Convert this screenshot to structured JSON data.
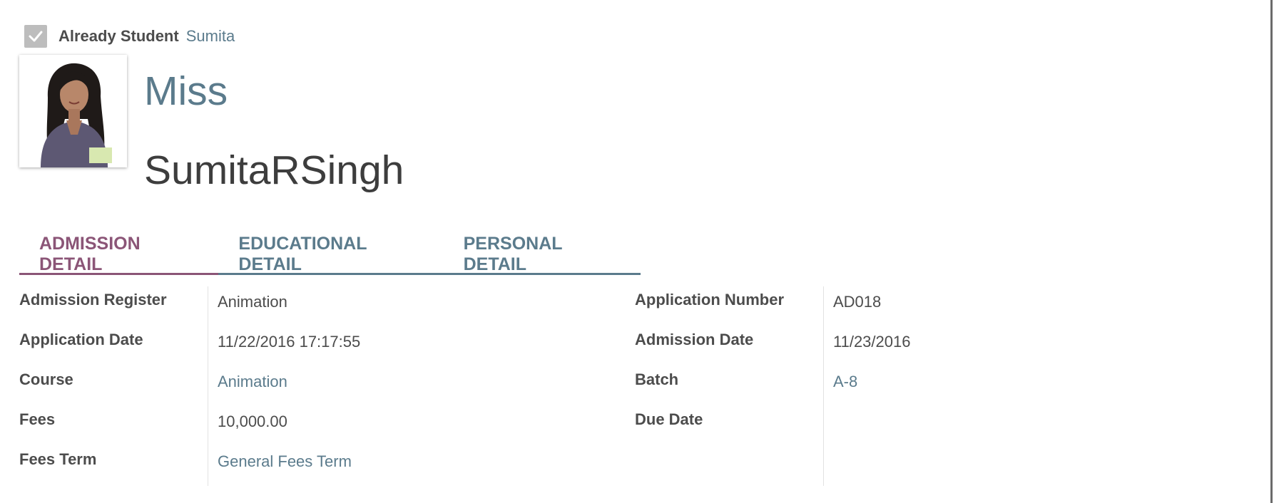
{
  "header": {
    "already_student_label": "Already Student",
    "already_student_checked": true,
    "partner_link": "Sumita",
    "title": "Miss",
    "name": "SumitaRSingh"
  },
  "tabs": [
    {
      "label": "ADMISSION DETAIL",
      "active": true
    },
    {
      "label": "EDUCATIONAL DETAIL",
      "active": false
    },
    {
      "label": "PERSONAL DETAIL",
      "active": false
    }
  ],
  "admission_left": {
    "admission_register": {
      "label": "Admission Register",
      "value": "Animation"
    },
    "application_date": {
      "label": "Application Date",
      "value": "11/22/2016 17:17:55"
    },
    "course": {
      "label": "Course",
      "value": "Animation"
    },
    "fees": {
      "label": "Fees",
      "value": "10,000.00"
    },
    "fees_term": {
      "label": "Fees Term",
      "value": "General Fees Term"
    }
  },
  "admission_right": {
    "application_number": {
      "label": "Application Number",
      "value": "AD018"
    },
    "admission_date": {
      "label": "Admission Date",
      "value": "11/23/2016"
    },
    "batch": {
      "label": "Batch",
      "value": "A-8"
    },
    "due_date": {
      "label": "Due Date",
      "value": ""
    }
  },
  "colors": {
    "accent": "#5b7b8c",
    "active_tab": "#8b5577",
    "text": "#4c4c4c"
  }
}
